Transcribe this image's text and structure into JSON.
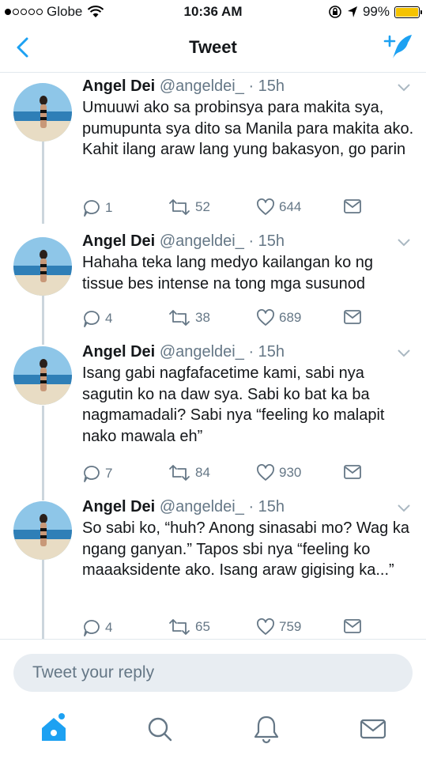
{
  "status_bar": {
    "carrier": "Globe",
    "time": "10:36 AM",
    "battery": "99%",
    "battery_level": 0.99
  },
  "nav": {
    "title": "Tweet"
  },
  "tweets": [
    {
      "name": "Angel Dei",
      "handle": "@angeldei_",
      "time": "· 15h",
      "text": "Umuuwi ako sa probinsya para makita sya, pumupunta sya dito sa Manila para makita ako. Kahit ilang araw lang yung bakasyon, go parin",
      "replies": "1",
      "retweets": "52",
      "likes": "644"
    },
    {
      "name": "Angel Dei",
      "handle": "@angeldei_",
      "time": "· 15h",
      "text": "Hahaha teka lang medyo kailangan ko ng tissue bes intense na tong mga susunod",
      "replies": "4",
      "retweets": "38",
      "likes": "689"
    },
    {
      "name": "Angel Dei",
      "handle": "@angeldei_",
      "time": "· 15h",
      "text": "Isang gabi nagfafacetime kami, sabi nya sagutin ko na daw sya. Sabi ko bat ka ba nagmamadali? Sabi nya “feeling ko malapit nako mawala eh”",
      "replies": "7",
      "retweets": "84",
      "likes": "930"
    },
    {
      "name": "Angel Dei",
      "handle": "@angeldei_",
      "time": "· 15h",
      "text": "So sabi ko, “huh? Anong sinasabi mo? Wag ka ngang ganyan.” Tapos sbi nya “feeling ko maaaksidente ako. Isang araw gigising ka...”",
      "replies": "4",
      "retweets": "65",
      "likes": "759"
    }
  ],
  "reply": {
    "placeholder": "Tweet your reply"
  },
  "tabs": [
    "home-icon",
    "search-icon",
    "notifications-icon",
    "messages-icon"
  ],
  "colors": {
    "accent": "#1da1f2",
    "text": "#14171a",
    "secondary": "#657786",
    "border": "#e1e8ed",
    "reply_bg": "#e8edf2",
    "battery": "#f5c300"
  }
}
